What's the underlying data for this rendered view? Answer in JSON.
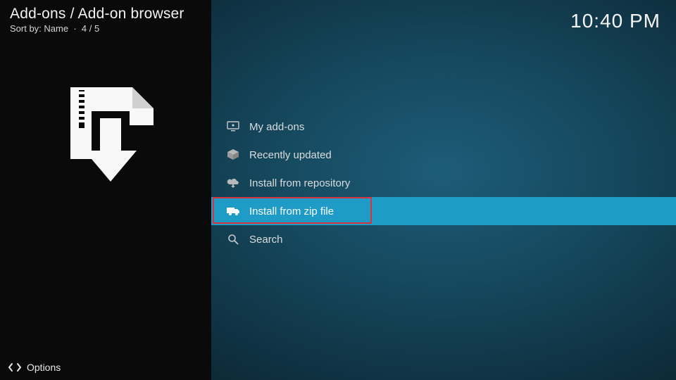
{
  "header": {
    "title": "Add-ons / Add-on browser",
    "sort_prefix": "Sort by:",
    "sort_value": "Name",
    "position": "4 / 5"
  },
  "clock": "10:40 PM",
  "sidebar": {
    "icon": "install-zip-icon"
  },
  "menu": {
    "items": [
      {
        "id": "my-addons",
        "label": "My add-ons",
        "icon": "monitor-icon",
        "selected": false
      },
      {
        "id": "recently-updated",
        "label": "Recently updated",
        "icon": "box-refresh-icon",
        "selected": false
      },
      {
        "id": "install-repository",
        "label": "Install from repository",
        "icon": "cloud-download-icon",
        "selected": false
      },
      {
        "id": "install-zip",
        "label": "Install from zip file",
        "icon": "zip-truck-icon",
        "selected": true
      },
      {
        "id": "search",
        "label": "Search",
        "icon": "search-icon",
        "selected": false
      }
    ]
  },
  "footer": {
    "options_label": "Options"
  },
  "colors": {
    "highlight": "#1e9cc7",
    "annotation": "#d9343e"
  }
}
